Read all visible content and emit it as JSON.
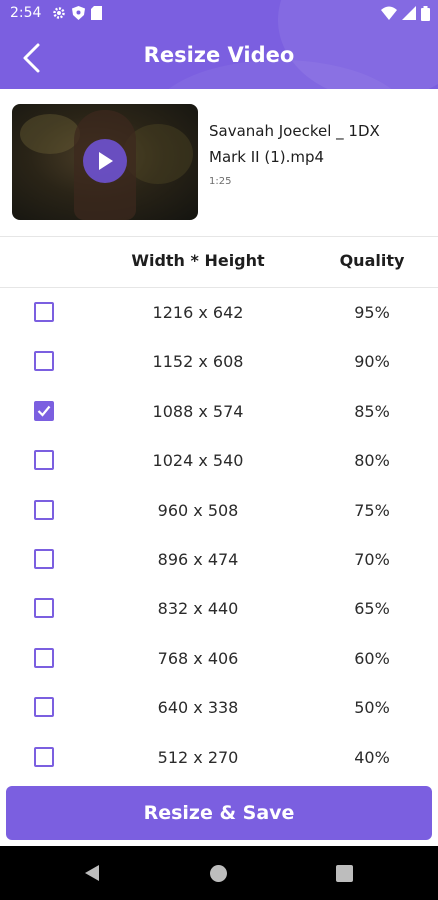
{
  "status_bar": {
    "time": "2:54"
  },
  "header": {
    "title": "Resize Video"
  },
  "video": {
    "name": "Savanah Joeckel _ 1DX Mark II (1).mp4",
    "duration": "1:25"
  },
  "table": {
    "headers": {
      "size": "Width * Height",
      "quality": "Quality"
    },
    "rows": [
      {
        "size": "1216 x 642",
        "quality": "95%",
        "checked": false
      },
      {
        "size": "1152 x 608",
        "quality": "90%",
        "checked": false
      },
      {
        "size": "1088 x 574",
        "quality": "85%",
        "checked": true
      },
      {
        "size": "1024 x 540",
        "quality": "80%",
        "checked": false
      },
      {
        "size": "960 x 508",
        "quality": "75%",
        "checked": false
      },
      {
        "size": "896 x 474",
        "quality": "70%",
        "checked": false
      },
      {
        "size": "832 x 440",
        "quality": "65%",
        "checked": false
      },
      {
        "size": "768 x 406",
        "quality": "60%",
        "checked": false
      },
      {
        "size": "640 x 338",
        "quality": "50%",
        "checked": false
      },
      {
        "size": "512 x 270",
        "quality": "40%",
        "checked": false
      }
    ]
  },
  "actions": {
    "save_label": "Resize & Save"
  },
  "colors": {
    "accent": "#7b5fe0"
  }
}
